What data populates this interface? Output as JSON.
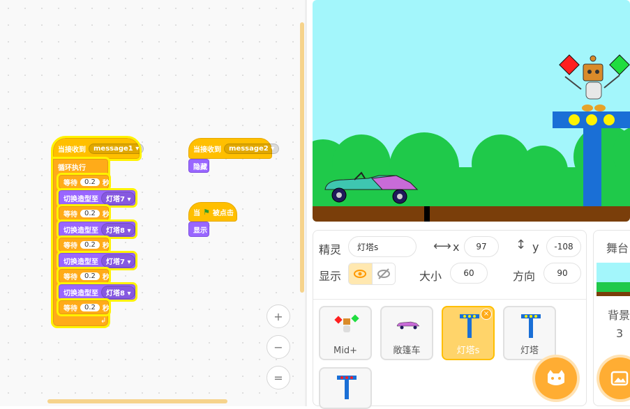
{
  "scripts": {
    "script1": {
      "hat_label": "当接收到",
      "hat_message": "message1",
      "forever_label": "循环执行",
      "wait_label": "等待",
      "wait_value": "0.2",
      "wait_unit": "秒",
      "switch_label": "切换造型至",
      "costume_a": "灯塔7",
      "costume_b": "灯塔8"
    },
    "script2": {
      "hat_label": "当接收到",
      "hat_message": "message2",
      "action": "隐藏"
    },
    "script3": {
      "hat_label": "当",
      "hat_suffix": "被点击",
      "action": "显示"
    }
  },
  "zoom": {
    "zoom_in": "+",
    "zoom_out": "−",
    "reset": "="
  },
  "sprite_info": {
    "sprite_label": "精灵",
    "sprite_name": "灯塔s",
    "x_label": "x",
    "x_value": "97",
    "y_label": "y",
    "y_value": "-108",
    "show_label": "显示",
    "size_label": "大小",
    "size_value": "60",
    "direction_label": "方向",
    "direction_value": "90"
  },
  "sprites": [
    {
      "name": "Mid+",
      "icon": "robot-flags-icon"
    },
    {
      "name": "敞篷车",
      "icon": "convertible-car-icon"
    },
    {
      "name": "灯塔s",
      "icon": "tower-icon",
      "selected": true
    },
    {
      "name": "灯塔",
      "icon": "tower-icon"
    },
    {
      "name": "",
      "icon": "tower-icon"
    }
  ],
  "stage_panel": {
    "tab": "舞台",
    "backdrop_label": "背景",
    "backdrop_count": "3"
  },
  "colors": {
    "event": "#ffbf00",
    "control": "#ffab19",
    "looks": "#9966ff",
    "accent": "#ffad33",
    "stage_sky": "#a3f6fb",
    "grass": "#1fc94a"
  }
}
